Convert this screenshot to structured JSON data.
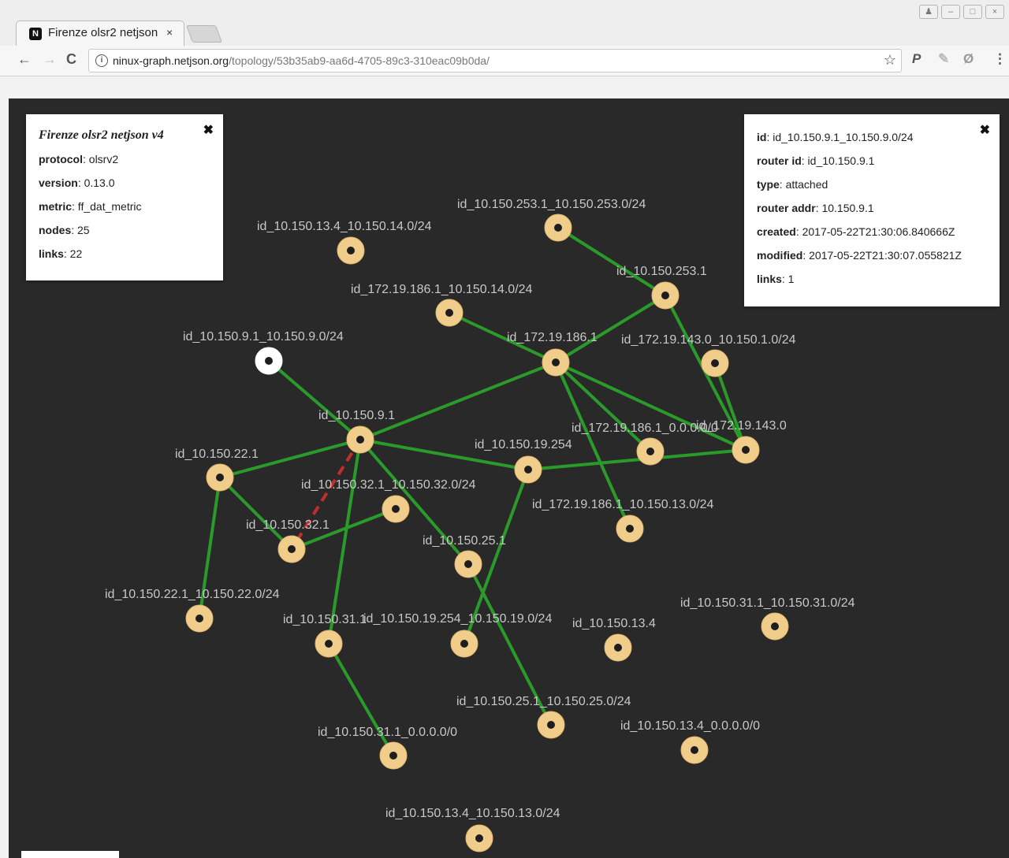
{
  "browser": {
    "tab_title": "Firenze olsr2 netjson",
    "tab_close": "×",
    "url_host": "ninux-graph.netjson.org",
    "url_path": "/topology/53b35ab9-aa6d-4705-89c3-310eac09b0da/",
    "back": "←",
    "forward": "→",
    "reload": "C",
    "info": "i",
    "star": "☆",
    "ext_p": "P",
    "ext_feather": "✎",
    "ext_ghostery": "Ø",
    "menu": "⋮",
    "favicon": "N"
  },
  "meta_panel": {
    "title": "Firenze olsr2 netjson v4",
    "close": "✖",
    "rows": [
      {
        "key": "protocol",
        "value": ": olsrv2"
      },
      {
        "key": "version",
        "value": ": 0.13.0"
      },
      {
        "key": "metric",
        "value": ": ff_dat_metric"
      },
      {
        "key": "nodes",
        "value": ": 25"
      },
      {
        "key": "links",
        "value": ": 22"
      }
    ]
  },
  "node_panel": {
    "close": "✖",
    "rows": [
      {
        "key": "id",
        "value": ": id_10.150.9.1_10.150.9.0/24"
      },
      {
        "key": "router id",
        "value": ": id_10.150.9.1"
      },
      {
        "key": "type",
        "value": ": attached"
      },
      {
        "key": "router addr",
        "value": ": 10.150.9.1"
      },
      {
        "key": "created",
        "value": ": 2017-05-22T21:30:06.840666Z"
      },
      {
        "key": "modified",
        "value": ": 2017-05-22T21:30:07.055821Z"
      },
      {
        "key": "links",
        "value": ": 1"
      }
    ]
  },
  "graph": {
    "colors": {
      "background": "#292929",
      "node": "#f1cd8b",
      "link": "#2a9a2a",
      "dashed_link": "#c0302b",
      "selected_node": "#ffffff",
      "label": "#c8c8c8"
    },
    "nodes": [
      {
        "id": "n1",
        "label": "id_10.150.253.1_10.150.253.0/24"
      },
      {
        "id": "n2",
        "label": "id_10.150.13.4_10.150.14.0/24"
      },
      {
        "id": "n3",
        "label": "id_10.150.253.1"
      },
      {
        "id": "n4",
        "label": "id_172.19.186.1_10.150.14.0/24"
      },
      {
        "id": "n5",
        "label": "id_10.150.9.1_10.150.9.0/24",
        "selected": true
      },
      {
        "id": "n6",
        "label": "id_172.19.186.1"
      },
      {
        "id": "n7",
        "label": "id_172.19.143.0_10.150.1.0/24"
      },
      {
        "id": "n8",
        "label": "id_10.150.9.1"
      },
      {
        "id": "n9",
        "label": "id_172.19.186.1_0.0.0.0/0"
      },
      {
        "id": "n10",
        "label": "id_172.19.143.0"
      },
      {
        "id": "n11",
        "label": "id_10.150.22.1"
      },
      {
        "id": "n12",
        "label": "id_10.150.19.254"
      },
      {
        "id": "n13",
        "label": "id_10.150.32.1_10.150.32.0/24"
      },
      {
        "id": "n14",
        "label": "id_172.19.186.1_10.150.13.0/24"
      },
      {
        "id": "n15",
        "label": "id_10.150.32.1"
      },
      {
        "id": "n16",
        "label": "id_10.150.25.1"
      },
      {
        "id": "n17",
        "label": "id_10.150.22.1_10.150.22.0/24"
      },
      {
        "id": "n18",
        "label": "id_10.150.31.1"
      },
      {
        "id": "n19",
        "label": "id_10.150.19.254_10.150.19.0/24"
      },
      {
        "id": "n20",
        "label": "id_10.150.13.4"
      },
      {
        "id": "n21",
        "label": "id_10.150.31.1_10.150.31.0/24"
      },
      {
        "id": "n22",
        "label": "id_10.150.25.1_10.150.25.0/24"
      },
      {
        "id": "n23",
        "label": "id_10.150.13.4_0.0.0.0/0"
      },
      {
        "id": "n24",
        "label": "id_10.150.31.1_0.0.0.0/0"
      },
      {
        "id": "n25",
        "label": "id_10.150.13.4_10.150.13.0/24"
      }
    ],
    "links": [
      {
        "source": "n1",
        "target": "n3"
      },
      {
        "source": "n3",
        "target": "n6"
      },
      {
        "source": "n3",
        "target": "n10"
      },
      {
        "source": "n7",
        "target": "n10"
      },
      {
        "source": "n4",
        "target": "n6"
      },
      {
        "source": "n6",
        "target": "n8"
      },
      {
        "source": "n6",
        "target": "n9"
      },
      {
        "source": "n6",
        "target": "n10"
      },
      {
        "source": "n6",
        "target": "n14"
      },
      {
        "source": "n5",
        "target": "n8"
      },
      {
        "source": "n8",
        "target": "n11"
      },
      {
        "source": "n8",
        "target": "n12"
      },
      {
        "source": "n8",
        "target": "n16"
      },
      {
        "source": "n8",
        "target": "n18"
      },
      {
        "source": "n8",
        "target": "n15",
        "dashed": true
      },
      {
        "source": "n12",
        "target": "n10"
      },
      {
        "source": "n11",
        "target": "n15"
      },
      {
        "source": "n11",
        "target": "n17"
      },
      {
        "source": "n15",
        "target": "n13"
      },
      {
        "source": "n12",
        "target": "n19"
      },
      {
        "source": "n16",
        "target": "n22"
      },
      {
        "source": "n18",
        "target": "n24"
      }
    ]
  }
}
